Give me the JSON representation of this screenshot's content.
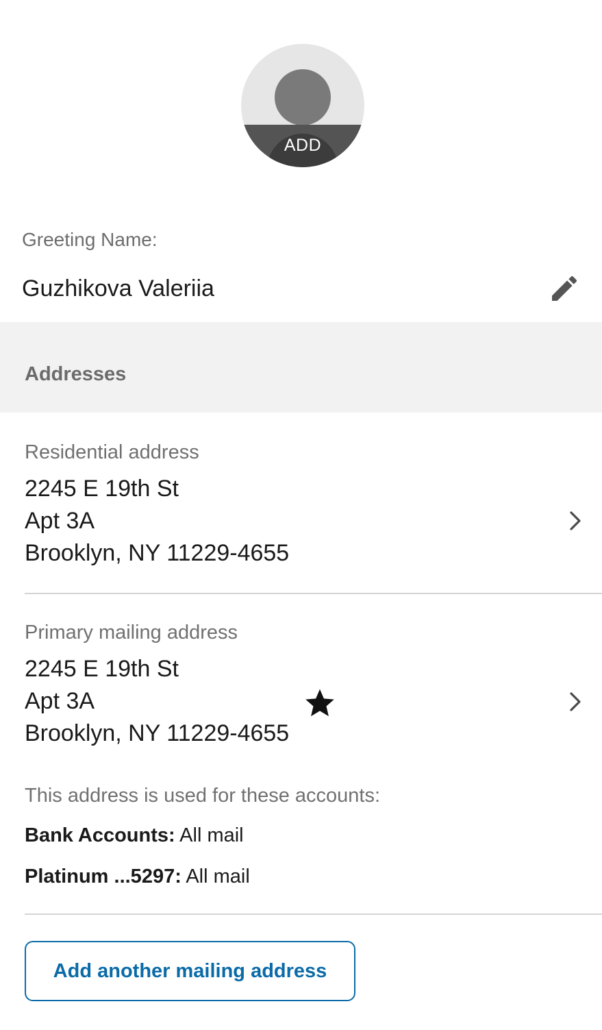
{
  "avatar": {
    "add_label": "ADD"
  },
  "greeting": {
    "label": "Greeting Name:",
    "value": "Guzhikova Valeriia"
  },
  "addresses": {
    "section_title": "Addresses",
    "residential": {
      "label": "Residential address",
      "lines": [
        "2245 E 19th St",
        "Apt 3A",
        "Brooklyn, NY 11229-4655"
      ]
    },
    "primary_mailing": {
      "label": "Primary mailing address",
      "lines": [
        "2245 E 19th St",
        "Apt 3A",
        "Brooklyn, NY 11229-4655"
      ],
      "usage_intro": "This address is used for these accounts:",
      "accounts": [
        {
          "name": "Bank Accounts:",
          "value": "All mail"
        },
        {
          "name": "Platinum ...5297:",
          "value": "All mail"
        }
      ]
    },
    "add_button_label": "Add another mailing address"
  },
  "icons": {
    "edit": "pencil-icon",
    "primary": "star-icon",
    "row_arrow": "chevron-right-icon"
  },
  "colors": {
    "accent": "#0a6ba8",
    "section_bg": "#f2f2f2",
    "muted_text": "#707070"
  }
}
